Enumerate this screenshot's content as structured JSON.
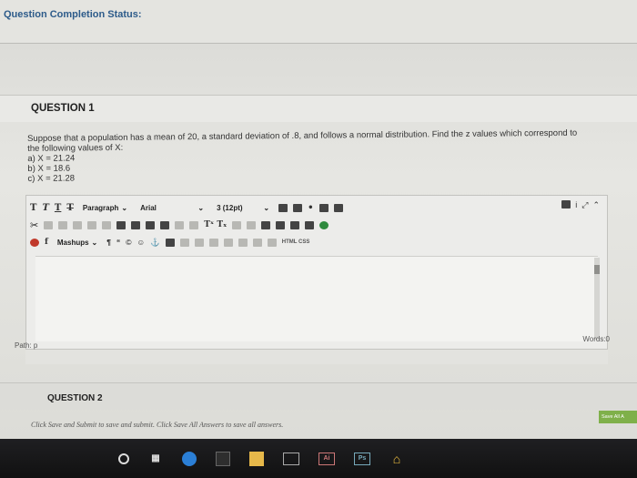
{
  "status": {
    "title": "Question Completion Status:"
  },
  "question1": {
    "label": "QUESTION 1",
    "lines": [
      "Suppose that a population has a mean of 20, a standard deviation of .8, and follows a normal distribution. Find the z values which correspond to",
      "the following values of X:",
      "a) X = 21.24",
      "b) X = 18.6",
      "c) X = 21.28"
    ]
  },
  "editor": {
    "row1": {
      "format_buttons": [
        "T",
        "T",
        "T",
        "T"
      ],
      "paragraph": "Paragraph",
      "font": "Arial",
      "size": "3 (12pt)"
    },
    "row2": {
      "sup_sub": "Tˣ Tₓ"
    },
    "row3": {
      "mashups": "Mashups",
      "html_css": "HTML CSS"
    },
    "words": "Words:0",
    "path": "Path: p"
  },
  "question2": {
    "label": "QUESTION 2"
  },
  "footer": {
    "instructions": "Click Save and Submit to save and submit. Click Save All Answers to save all answers.",
    "save_all": "Save All A"
  },
  "taskbar": {
    "items": [
      "search-circle",
      "task-view",
      "edge",
      "films",
      "explorer",
      "word-box",
      "ai",
      "ps",
      "home"
    ],
    "ai_label": "Ai",
    "ps_label": "Ps"
  }
}
